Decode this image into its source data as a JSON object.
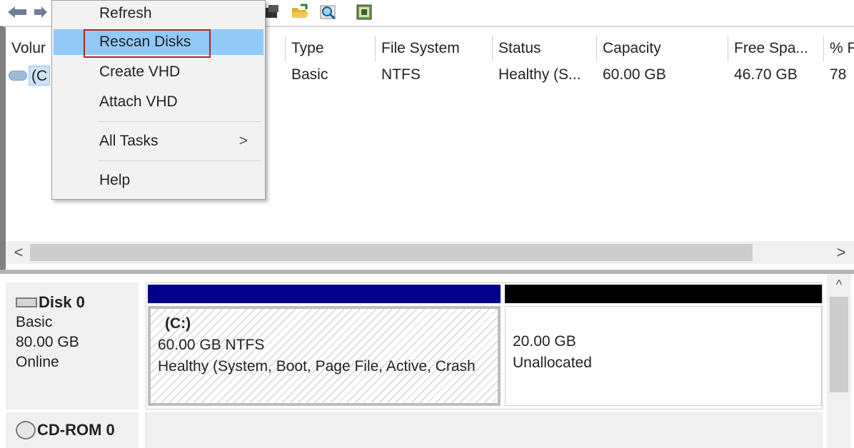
{
  "toolbar": {
    "back_icon": "back-arrow-icon",
    "forward_icon": "forward-arrow-icon",
    "icons": [
      "properties-icon",
      "open-folder-icon",
      "find-icon",
      "disk-properties-icon"
    ]
  },
  "volume_list": {
    "columns": [
      "Volur",
      "Type",
      "File System",
      "Status",
      "Capacity",
      "Free Spa...",
      "% F"
    ],
    "rows": [
      {
        "volume": "(C",
        "type": "Basic",
        "file_system": "NTFS",
        "status": "Healthy (S...",
        "capacity": "60.00 GB",
        "free_space": "46.70 GB",
        "percent_free": "78"
      }
    ]
  },
  "context_menu": {
    "items": [
      {
        "label": "Refresh"
      },
      {
        "label": "Rescan Disks",
        "selected": true
      },
      {
        "label": "Create VHD"
      },
      {
        "label": "Attach VHD"
      },
      {
        "label": "All Tasks",
        "submenu": true
      },
      {
        "label": "Help"
      }
    ],
    "submenu_arrow": ">"
  },
  "scrollbar": {
    "left_arrow": "<",
    "right_arrow": ">",
    "up_arrow": "^"
  },
  "disks": [
    {
      "name": "Disk 0",
      "type": "Basic",
      "size": "80.00 GB",
      "status": "Online",
      "partitions": [
        {
          "label": "(C:)",
          "size_fs": "60.00 GB NTFS",
          "status": "Healthy (System, Boot, Page File, Active, Crash",
          "bar_color": "#00008b"
        },
        {
          "label": "",
          "size_fs": "20.00 GB",
          "status": "Unallocated",
          "bar_color": "#000000"
        }
      ]
    },
    {
      "name": "CD-ROM 0"
    }
  ],
  "colors": {
    "menu_selection": "#91c9f7",
    "highlight_border": "#b22222",
    "primary_partition": "#00008b",
    "unallocated": "#000000"
  }
}
